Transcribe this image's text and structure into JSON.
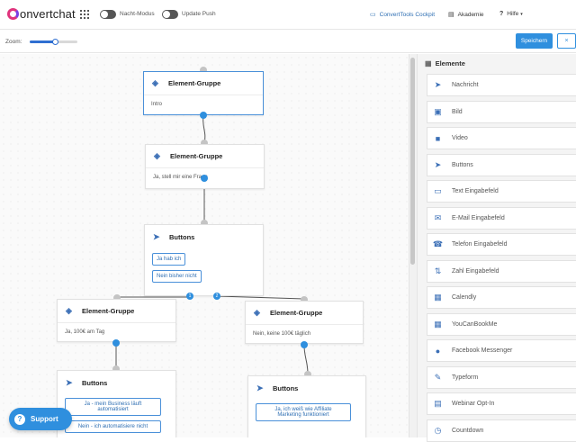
{
  "topbar": {
    "logo": "onvertchat",
    "night_mode": "Nacht-Modus",
    "update_push": "Update Push",
    "cockpit": "ConvertTools Cockpit",
    "academy": "Akademie",
    "help": "Hilfe"
  },
  "zoom": {
    "label": "Zoom:",
    "level": 0.55
  },
  "actions": {
    "save": "Speichern",
    "close": "×"
  },
  "nodes": {
    "intro": {
      "title": "Element-Gruppe",
      "text": "Intro"
    },
    "question": {
      "title": "Element-Gruppe",
      "text": "Ja, stell mir eine Frage"
    },
    "buttons1": {
      "title": "Buttons",
      "btn1": "Ja hab ich",
      "btn2": "Nein bisher nicht"
    },
    "group_left": {
      "title": "Element-Gruppe",
      "text": "Ja, 100€ am Tag"
    },
    "group_right": {
      "title": "Element-Gruppe",
      "text": "Nein, keine 100€ täglich"
    },
    "buttons_left": {
      "title": "Buttons",
      "btn1_line1": "Ja - mein Business läuft",
      "btn1_line2": "automatisiert",
      "btn2": "Nein - ich automatisiere nicht"
    },
    "buttons_right": {
      "title": "Buttons",
      "btn1_line1": "Ja, ich weiß wie Affiliate",
      "btn1_line2": "Marketing funktioniert"
    },
    "port_labels": [
      "1",
      "2"
    ]
  },
  "support": {
    "label": "Support"
  },
  "sidebar": {
    "title": "Elemente",
    "items": [
      {
        "label": "Nachricht",
        "icon": "send-icon"
      },
      {
        "label": "Bild",
        "icon": "image-icon"
      },
      {
        "label": "Video",
        "icon": "video-icon"
      },
      {
        "label": "Buttons",
        "icon": "cursor-icon"
      },
      {
        "label": "Text Eingabefeld",
        "icon": "text-input-icon"
      },
      {
        "label": "E-Mail Eingabefeld",
        "icon": "email-icon"
      },
      {
        "label": "Telefon Eingabefeld",
        "icon": "phone-icon"
      },
      {
        "label": "Zahl Eingabefeld",
        "icon": "number-icon"
      },
      {
        "label": "Calendly",
        "icon": "calendar-icon"
      },
      {
        "label": "YouCanBookMe",
        "icon": "calendar-icon"
      },
      {
        "label": "Facebook Messenger",
        "icon": "messenger-icon"
      },
      {
        "label": "Typeform",
        "icon": "typeform-icon"
      },
      {
        "label": "Webinar Opt-In",
        "icon": "webinar-icon"
      },
      {
        "label": "Countdown",
        "icon": "clock-icon"
      }
    ]
  },
  "colors": {
    "accent": "#2f8fde",
    "brand": "#e0347d"
  }
}
